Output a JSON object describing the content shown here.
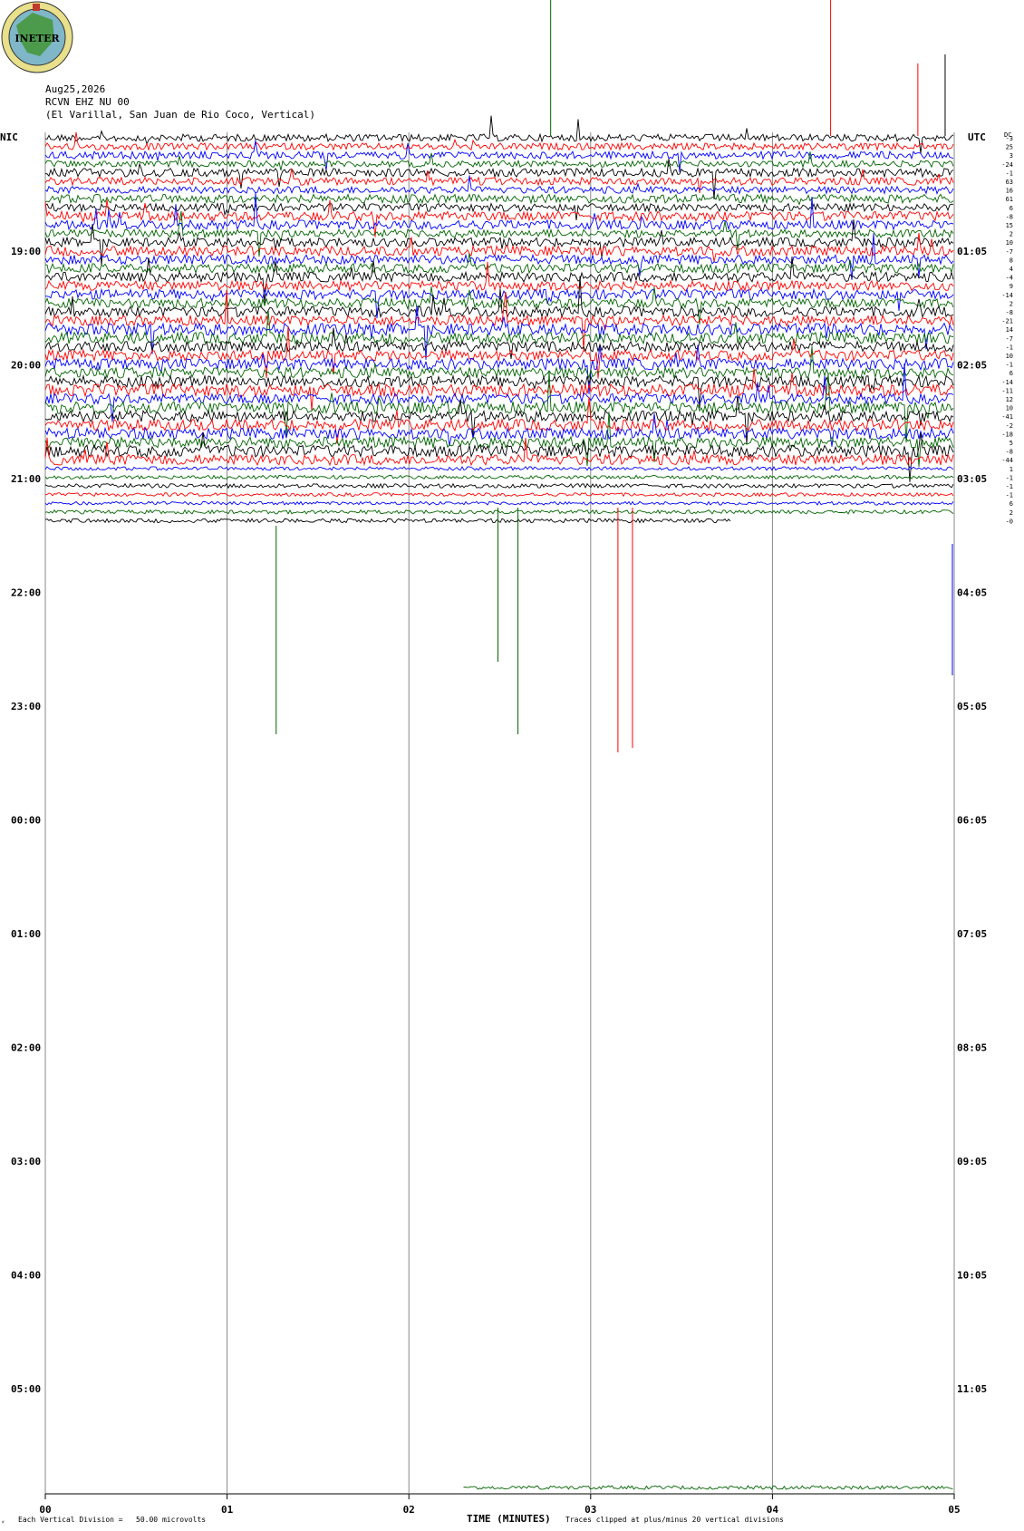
{
  "header": {
    "date": "Aug25,2026",
    "channel": "RCVN EHZ NU 00",
    "station": "(El Varillal, San Juan de Rio Coco, Vertical)"
  },
  "logo": {
    "label": "INETER"
  },
  "left_tz": "NIC",
  "right_tz": "UTC",
  "dc_label": "DC",
  "footer": {
    "scale_note": "Each Vertical Division =   50.00 microvolts",
    "clip_note": "Traces clipped at plus/minus 20 vertical divisions"
  },
  "colors": {
    "black": "#000000",
    "red": "#ff0000",
    "blue": "#0000ff",
    "green": "#006400",
    "grid": "#888888"
  },
  "chart_data": {
    "type": "line",
    "xlabel": "TIME (MINUTES)",
    "x_ticks": [
      "00",
      "01",
      "02",
      "03",
      "04",
      "05"
    ],
    "xlim": [
      0,
      5
    ],
    "grid": true,
    "left_time_labels": [
      "19:00",
      "20:00",
      "21:00",
      "22:00",
      "23:00",
      "00:00",
      "01:00",
      "02:00",
      "03:00",
      "04:00",
      "05:00"
    ],
    "right_time_labels": [
      "01:05",
      "02:05",
      "03:05",
      "04:05",
      "05:05",
      "06:05",
      "07:05",
      "08:05",
      "09:05",
      "10:05",
      "11:05"
    ],
    "dc_offsets": [
      "-3",
      "25",
      "3",
      "-24",
      "-1",
      "63",
      "16",
      "61",
      "6",
      "-8",
      "15",
      "2",
      "10",
      "-7",
      "8",
      "4",
      "-4",
      "9",
      "-14",
      "2",
      "-8",
      "-21",
      "14",
      "-7",
      "-1",
      "10",
      "-1",
      "6",
      "-14",
      "-11",
      "12",
      "10",
      "-41",
      "-2",
      "-18",
      "5",
      "-8",
      "-44",
      "1",
      "-1",
      "-1",
      "-1",
      "6",
      "2",
      "-0"
    ],
    "trace_colors": [
      "black",
      "red",
      "blue",
      "green"
    ],
    "trace_count": 45,
    "last_trace_end_minutes": 3.77,
    "bottom_trace": {
      "color": "green",
      "start_minutes": 2.3,
      "end_minutes": 5
    }
  }
}
